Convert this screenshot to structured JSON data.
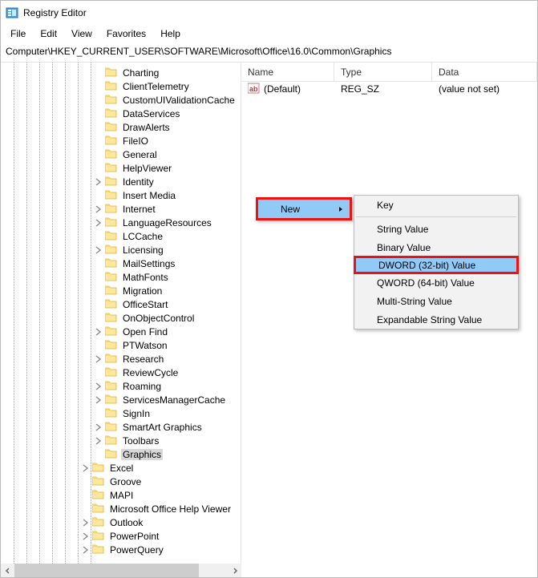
{
  "titlebar": {
    "title": "Registry Editor"
  },
  "menubar": [
    "File",
    "Edit",
    "View",
    "Favorites",
    "Help"
  ],
  "address": "Computer\\HKEY_CURRENT_USER\\SOFTWARE\\Microsoft\\Office\\16.0\\Common\\Graphics",
  "tree": {
    "a_items": [
      {
        "label": "Charting"
      },
      {
        "label": "ClientTelemetry"
      },
      {
        "label": "CustomUIValidationCache"
      },
      {
        "label": "DataServices"
      },
      {
        "label": "DrawAlerts"
      },
      {
        "label": "FileIO"
      },
      {
        "label": "General"
      },
      {
        "label": "HelpViewer"
      },
      {
        "label": "Identity",
        "expandable": true
      },
      {
        "label": "Insert Media"
      },
      {
        "label": "Internet",
        "expandable": true
      },
      {
        "label": "LanguageResources",
        "expandable": true
      },
      {
        "label": "LCCache"
      },
      {
        "label": "Licensing",
        "expandable": true
      },
      {
        "label": "MailSettings"
      },
      {
        "label": "MathFonts"
      },
      {
        "label": "Migration"
      },
      {
        "label": "OfficeStart"
      },
      {
        "label": "OnObjectControl"
      },
      {
        "label": "Open Find",
        "expandable": true
      },
      {
        "label": "PTWatson"
      },
      {
        "label": "Research",
        "expandable": true
      },
      {
        "label": "ReviewCycle"
      },
      {
        "label": "Roaming",
        "expandable": true
      },
      {
        "label": "ServicesManagerCache",
        "expandable": true
      },
      {
        "label": "SignIn"
      },
      {
        "label": "SmartArt Graphics",
        "expandable": true
      },
      {
        "label": "Toolbars",
        "expandable": true
      },
      {
        "label": "Graphics",
        "selected": true
      }
    ],
    "b_items": [
      {
        "label": "Excel",
        "expandable": true
      },
      {
        "label": "Groove"
      },
      {
        "label": "MAPI"
      },
      {
        "label": "Microsoft Office Help Viewer"
      },
      {
        "label": "Outlook",
        "expandable": true
      },
      {
        "label": "PowerPoint",
        "expandable": true
      },
      {
        "label": "PowerQuery",
        "expandable": true
      }
    ]
  },
  "list": {
    "columns": {
      "name": "Name",
      "type": "Type",
      "data": "Data"
    },
    "rows": [
      {
        "name": "(Default)",
        "type": "REG_SZ",
        "data": "(value not set)"
      }
    ]
  },
  "context_menu_1": {
    "items": [
      {
        "label": "New",
        "submenu": true,
        "hover": true
      }
    ]
  },
  "context_menu_2": {
    "items": [
      {
        "label": "Key"
      },
      {
        "sep": true
      },
      {
        "label": "String Value"
      },
      {
        "label": "Binary Value"
      },
      {
        "label": "DWORD (32-bit) Value",
        "emph": true,
        "hover": true
      },
      {
        "label": "QWORD (64-bit) Value"
      },
      {
        "label": "Multi-String Value"
      },
      {
        "label": "Expandable String Value"
      }
    ]
  }
}
